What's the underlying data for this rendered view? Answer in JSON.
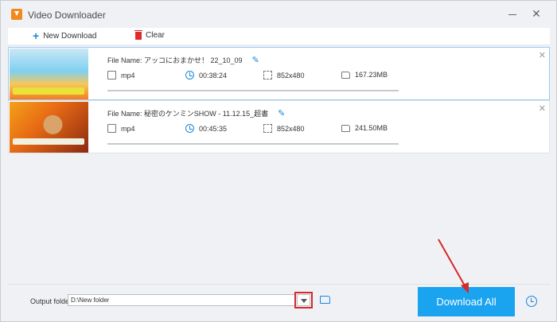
{
  "window": {
    "title": "Video Downloader"
  },
  "toolbar": {
    "new_download_label": "New Download",
    "clear_label": "Clear"
  },
  "items": [
    {
      "filename": "File Name: アッコにおまかせ！ 22_10_09",
      "format": "mp4",
      "duration": "00:38:24",
      "resolution": "852x480",
      "size": "167.23MB",
      "selected": true
    },
    {
      "filename": "File Name: 秘密のケンミンSHOW - 11.12.15_超書",
      "format": "mp4",
      "duration": "00:45:35",
      "resolution": "852x480",
      "size": "241.50MB",
      "selected": false
    }
  ],
  "bottom": {
    "output_label": "Output folder:",
    "output_value": "D:\\New folder",
    "download_all_label": "Download All"
  },
  "colors": {
    "accent": "#1aa3ef",
    "highlight": "#d32a2a",
    "danger": "#e02b2b"
  },
  "icons": [
    "app-icon",
    "minimize-icon",
    "close-icon",
    "plus-icon",
    "trash-icon",
    "edit-icon",
    "file-icon",
    "clock-icon",
    "resize-icon",
    "folder-icon",
    "chevron-down-icon",
    "folder-open-icon",
    "alarm-icon"
  ]
}
